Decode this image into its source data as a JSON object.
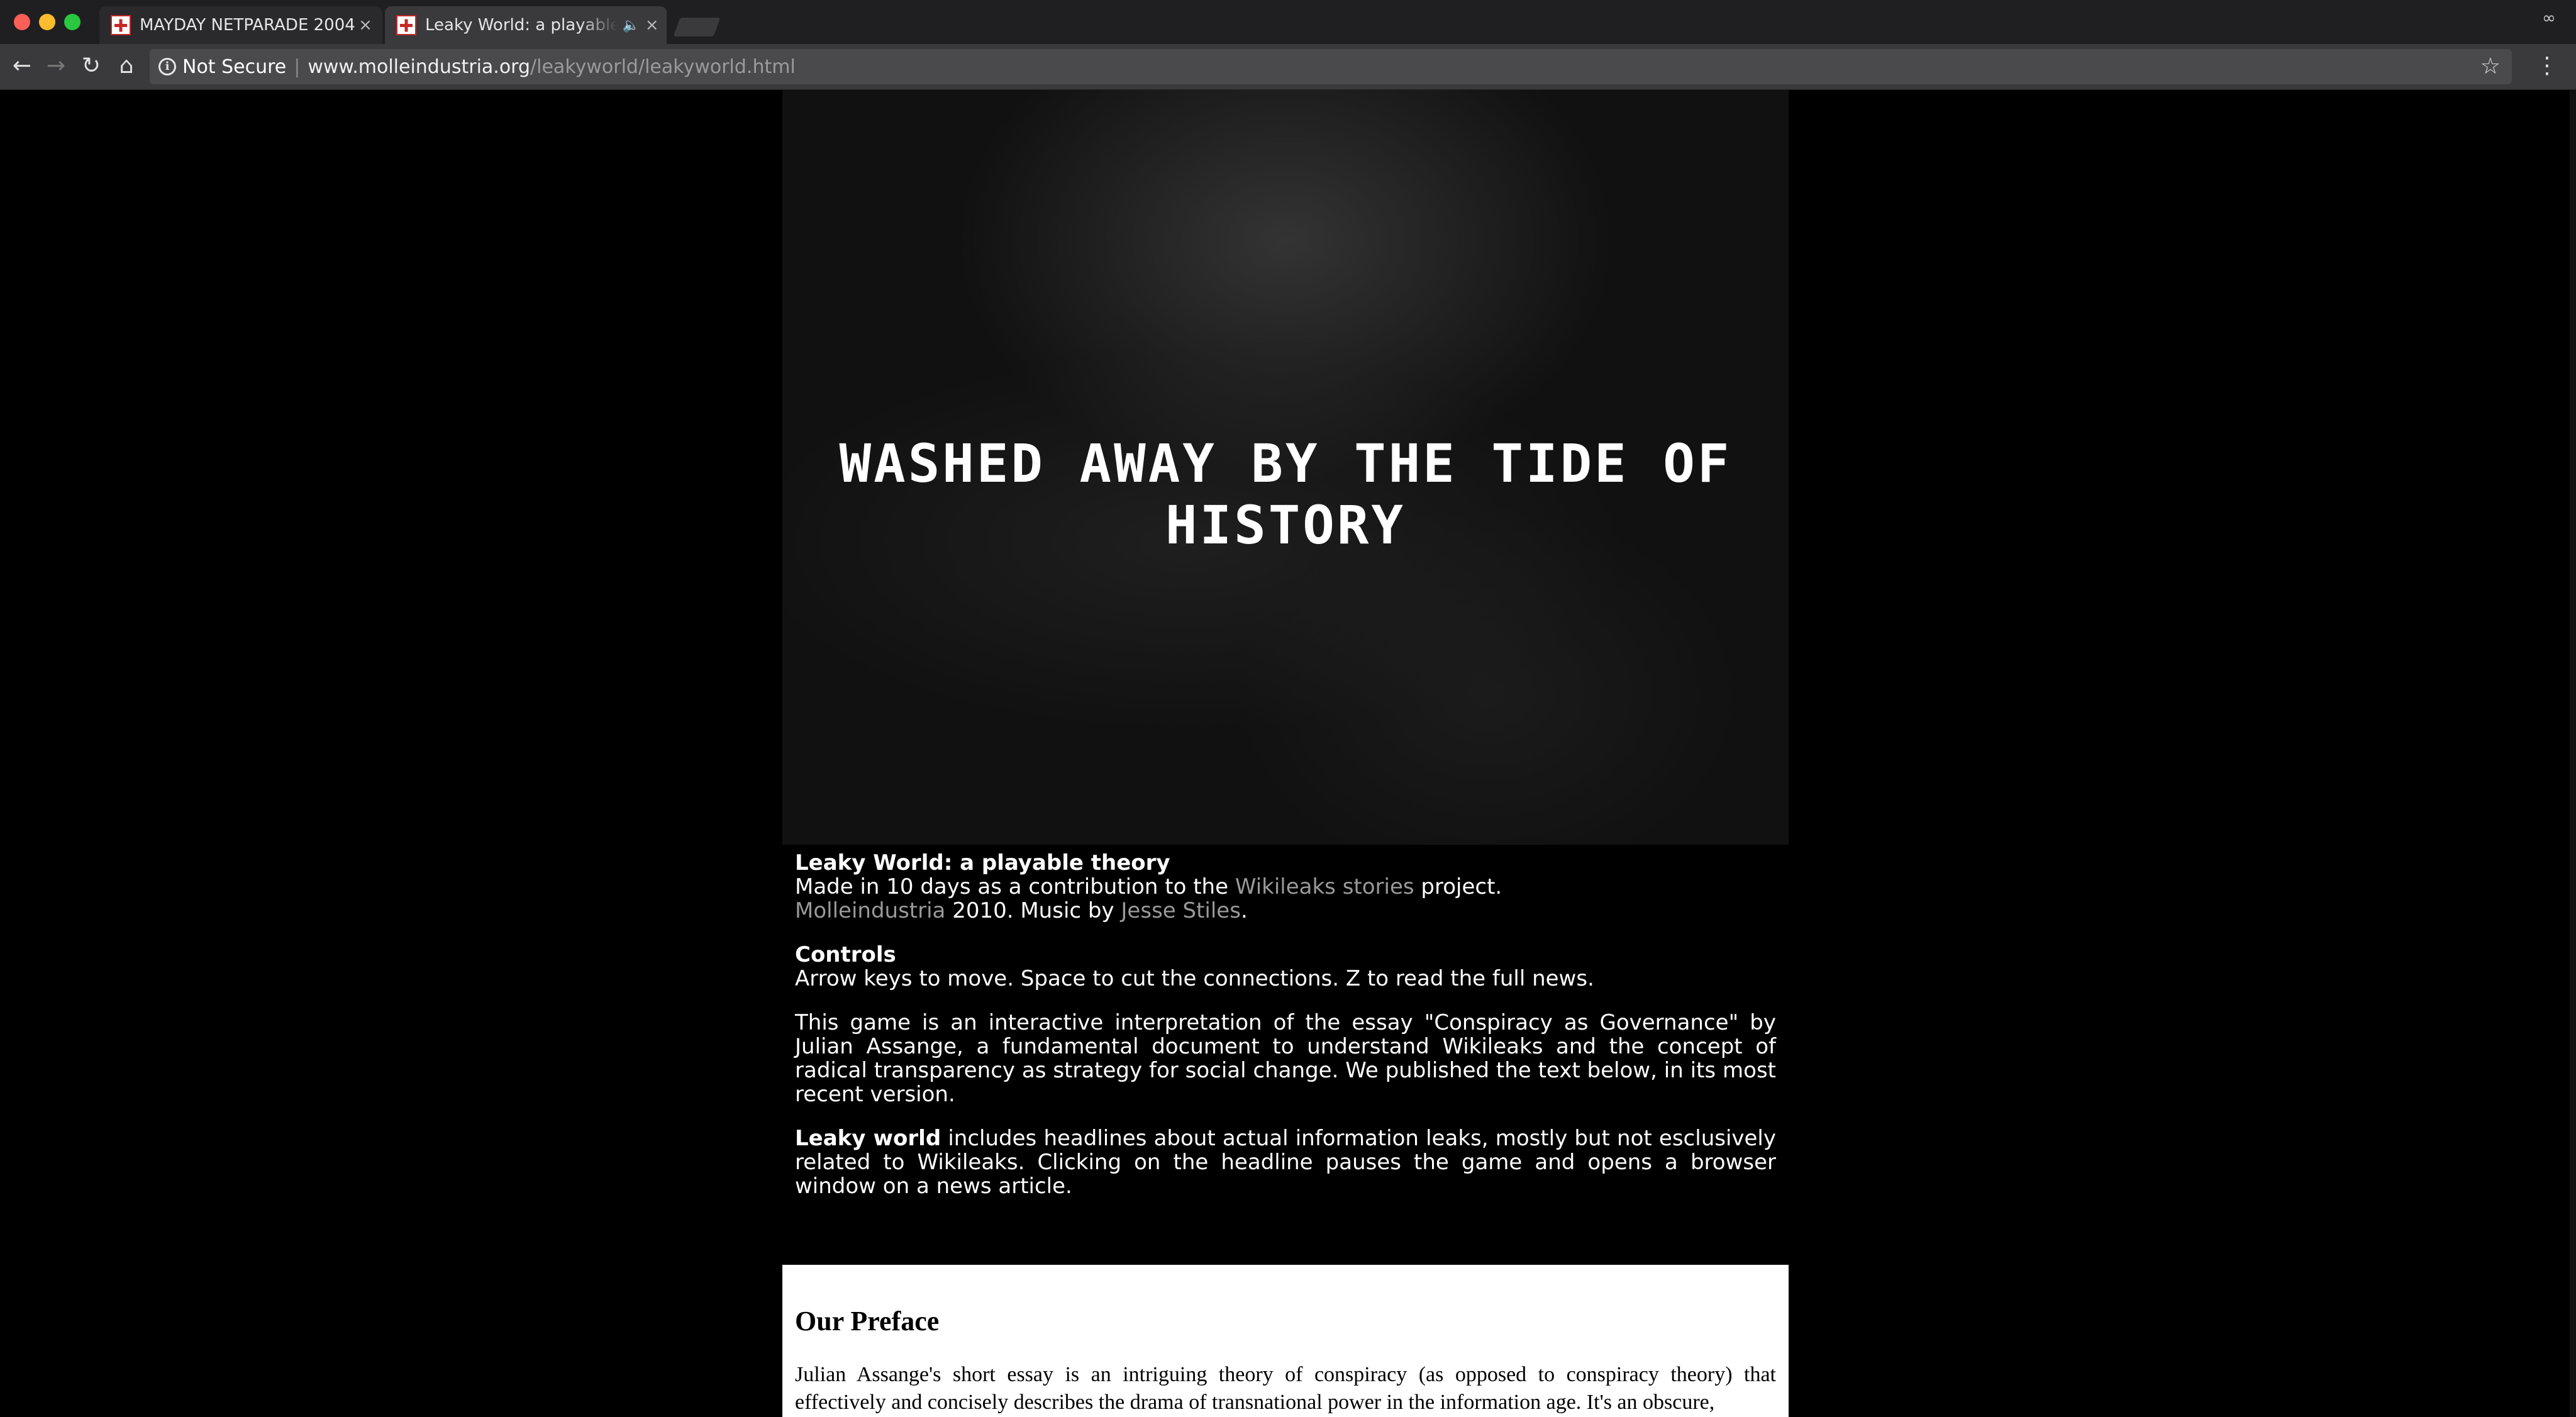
{
  "browser": {
    "tabs": [
      {
        "title": "MAYDAY NETPARADE 2004",
        "active": false
      },
      {
        "title": "Leaky World: a playable theory",
        "active": true,
        "audio": true
      }
    ],
    "address": {
      "security_label": "Not Secure",
      "host": "www.molleindustria.org",
      "path": "/leakyworld/leakyworld.html"
    },
    "icons": {
      "close": "×",
      "speaker": "🔈",
      "back": "←",
      "forward": "→",
      "reload": "↻",
      "home": "⌂",
      "info": "i",
      "star": "☆",
      "menu": "⋮",
      "incognito": "∞"
    }
  },
  "game": {
    "banner_text": "WASHED AWAY BY THE TIDE OF HISTORY"
  },
  "info": {
    "title": "Leaky World: a playable theory",
    "made_prefix": "Made in 10 days as a contribution to the ",
    "wikileaks_stories_link": "Wikileaks stories",
    "made_suffix": " project.",
    "molleindustria_link": "Molleindustria",
    "year_music": " 2010. Music by ",
    "jesse_link": "Jesse Stiles",
    "period": ".",
    "controls_heading": "Controls",
    "controls_text": "Arrow keys to move. Space to cut the connections. Z to read the full news.",
    "essay_text": "This game is an interactive interpretation of the essay \"Conspiracy as Governance\" by Julian Assange, a fundamental document to understand Wikileaks and the concept of radical transparency as strategy for social change. We published the text below, in its most recent version.",
    "leaky_bold": "Leaky world",
    "leaky_text": " includes headlines about actual information leaks, mostly but not esclusively related to Wikileaks. Clicking on the headline pauses the game and opens a browser window on a news article."
  },
  "preface": {
    "heading": "Our Preface",
    "text": "Julian Assange's short essay is an intriguing theory of conspiracy (as opposed to conspiracy theory) that effectively and concisely describes the drama of transnational power in the information age. It's an obscure,"
  }
}
